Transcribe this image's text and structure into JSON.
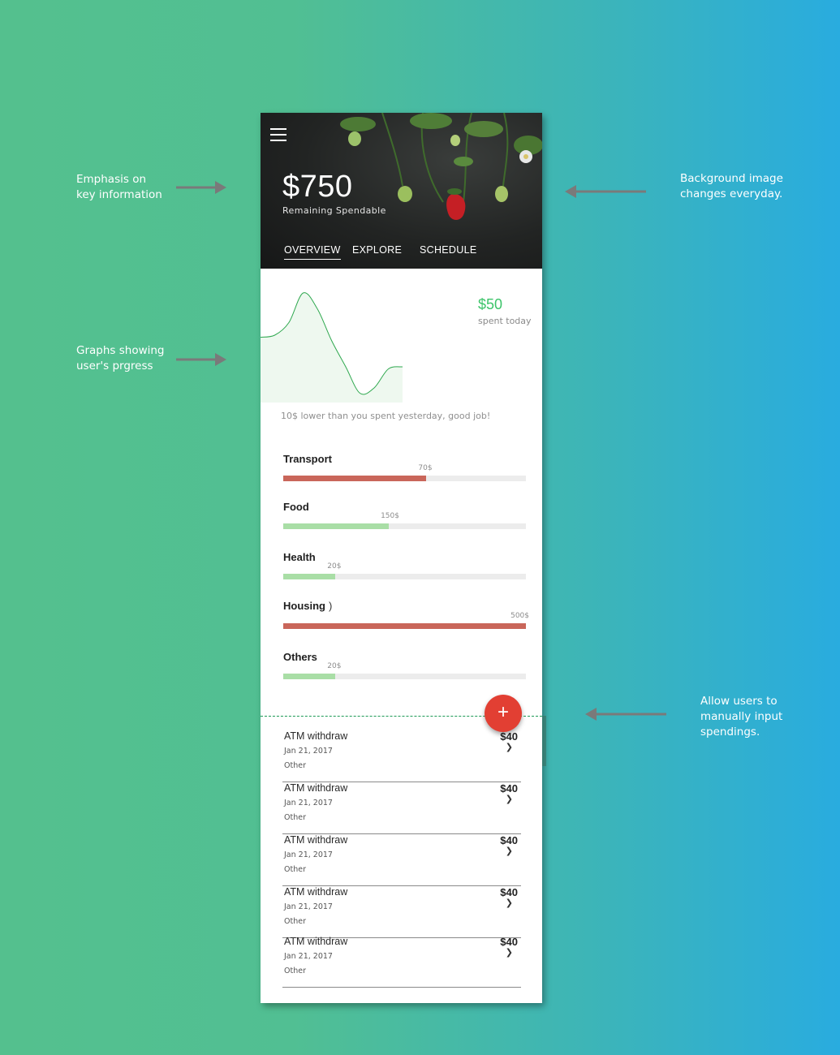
{
  "annotations": {
    "emphasis": "Emphasis on\nkey information",
    "background": "Background image\nchanges everyday.",
    "graphs": "Graphs showing\nuser's prgress",
    "manual_input": "Allow users to\nmanually input\nspendings."
  },
  "header": {
    "menu_icon": "hamburger-menu-icon",
    "amount": "$750",
    "amount_label": "Remaining Spendable"
  },
  "tabs": [
    {
      "label": "OVERVIEW",
      "active": true
    },
    {
      "label": "EXPLORE",
      "active": false
    },
    {
      "label": "SCHEDULE",
      "active": false
    }
  ],
  "overview": {
    "today_amount": "$50",
    "today_label": "spent today",
    "message": "10$ lower than you spent yesterday, good job!"
  },
  "chart_data": {
    "type": "area",
    "title": "",
    "xlabel": "",
    "ylabel": "",
    "x": [
      0,
      1,
      2,
      3,
      4,
      5,
      6,
      7,
      8,
      9,
      10
    ],
    "values": [
      0.58,
      0.6,
      0.72,
      1.0,
      0.85,
      0.55,
      0.3,
      0.05,
      0.1,
      0.28,
      0.3
    ],
    "color": "#2fa84f",
    "fill": "#eef8ef"
  },
  "categories": [
    {
      "name": "Transport",
      "extra": "",
      "value_label": "70$",
      "fraction": 0.59,
      "status": "over"
    },
    {
      "name": "Food",
      "extra": "",
      "value_label": "150$",
      "fraction": 0.435,
      "status": "ok"
    },
    {
      "name": "Health",
      "extra": "",
      "value_label": "20$",
      "fraction": 0.215,
      "status": "ok"
    },
    {
      "name": "Housing",
      "extra": ")",
      "value_label": "500$",
      "fraction": 1.0,
      "status": "over"
    },
    {
      "name": "Others",
      "extra": "",
      "value_label": "20$",
      "fraction": 0.215,
      "status": "ok"
    }
  ],
  "colors": {
    "over": "#c9665a",
    "ok": "#a9dea6",
    "fab": "#e23f33",
    "accent_green": "#3dc46a"
  },
  "fab": {
    "label": "+",
    "icon": "plus-icon"
  },
  "transactions": [
    {
      "title": "ATM withdraw",
      "date": "Jan 21, 2017",
      "tag": "Other",
      "amount": "$40"
    },
    {
      "title": "ATM withdraw",
      "date": "Jan 21, 2017",
      "tag": "Other",
      "amount": "$40"
    },
    {
      "title": "ATM withdraw",
      "date": "Jan 21, 2017",
      "tag": "Other",
      "amount": "$40"
    },
    {
      "title": "ATM withdraw",
      "date": "Jan 21, 2017",
      "tag": "Other",
      "amount": "$40"
    },
    {
      "title": "ATM withdraw",
      "date": "Jan 21, 2017",
      "tag": "Other",
      "amount": "$40"
    }
  ]
}
